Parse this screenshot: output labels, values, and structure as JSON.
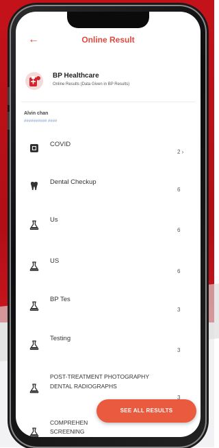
{
  "header": {
    "title": "Online Result",
    "back_icon": "arrow-left-icon"
  },
  "provider": {
    "name": "BP Healthcare",
    "subtitle": "Online Results (Data Given in BP Results)"
  },
  "patient": {
    "name": "Alvin chan",
    "id": "########## ####"
  },
  "colors": {
    "accent": "#e0483e",
    "fab": "#ea5a3f",
    "background": "#c4121a",
    "patient_id": "#7f93c9"
  },
  "results": [
    {
      "title": "COVID",
      "title_line2": "",
      "icon": "lab-report-icon",
      "meta": "",
      "count": "2 ›"
    },
    {
      "title": "Dental Checkup",
      "title_line2": "",
      "icon": "tooth-icon",
      "meta": "",
      "count": "6"
    },
    {
      "title": "Us",
      "title_line2": "",
      "icon": "flask-icon",
      "meta": "",
      "count": "6"
    },
    {
      "title": "US",
      "title_line2": "",
      "icon": "flask-icon",
      "meta": "",
      "count": "6"
    },
    {
      "title": "BP Tes",
      "title_line2": "",
      "icon": "flask-icon",
      "meta": "",
      "count": "3"
    },
    {
      "title": "Testing",
      "title_line2": "",
      "icon": "flask-icon",
      "meta": "",
      "count": "3"
    },
    {
      "title": "POST-TREATMENT PHOTOGRAPHY",
      "title_line2": "DENTAL RADIOGRAPHS",
      "icon": "flask-icon",
      "meta": "",
      "count": "3"
    },
    {
      "title": "COMPREHEN",
      "title_line2": "SCREENING",
      "icon": "flask-icon",
      "meta": "",
      "count": ""
    }
  ],
  "fab": {
    "label": "SEE ALL RESULTS"
  }
}
